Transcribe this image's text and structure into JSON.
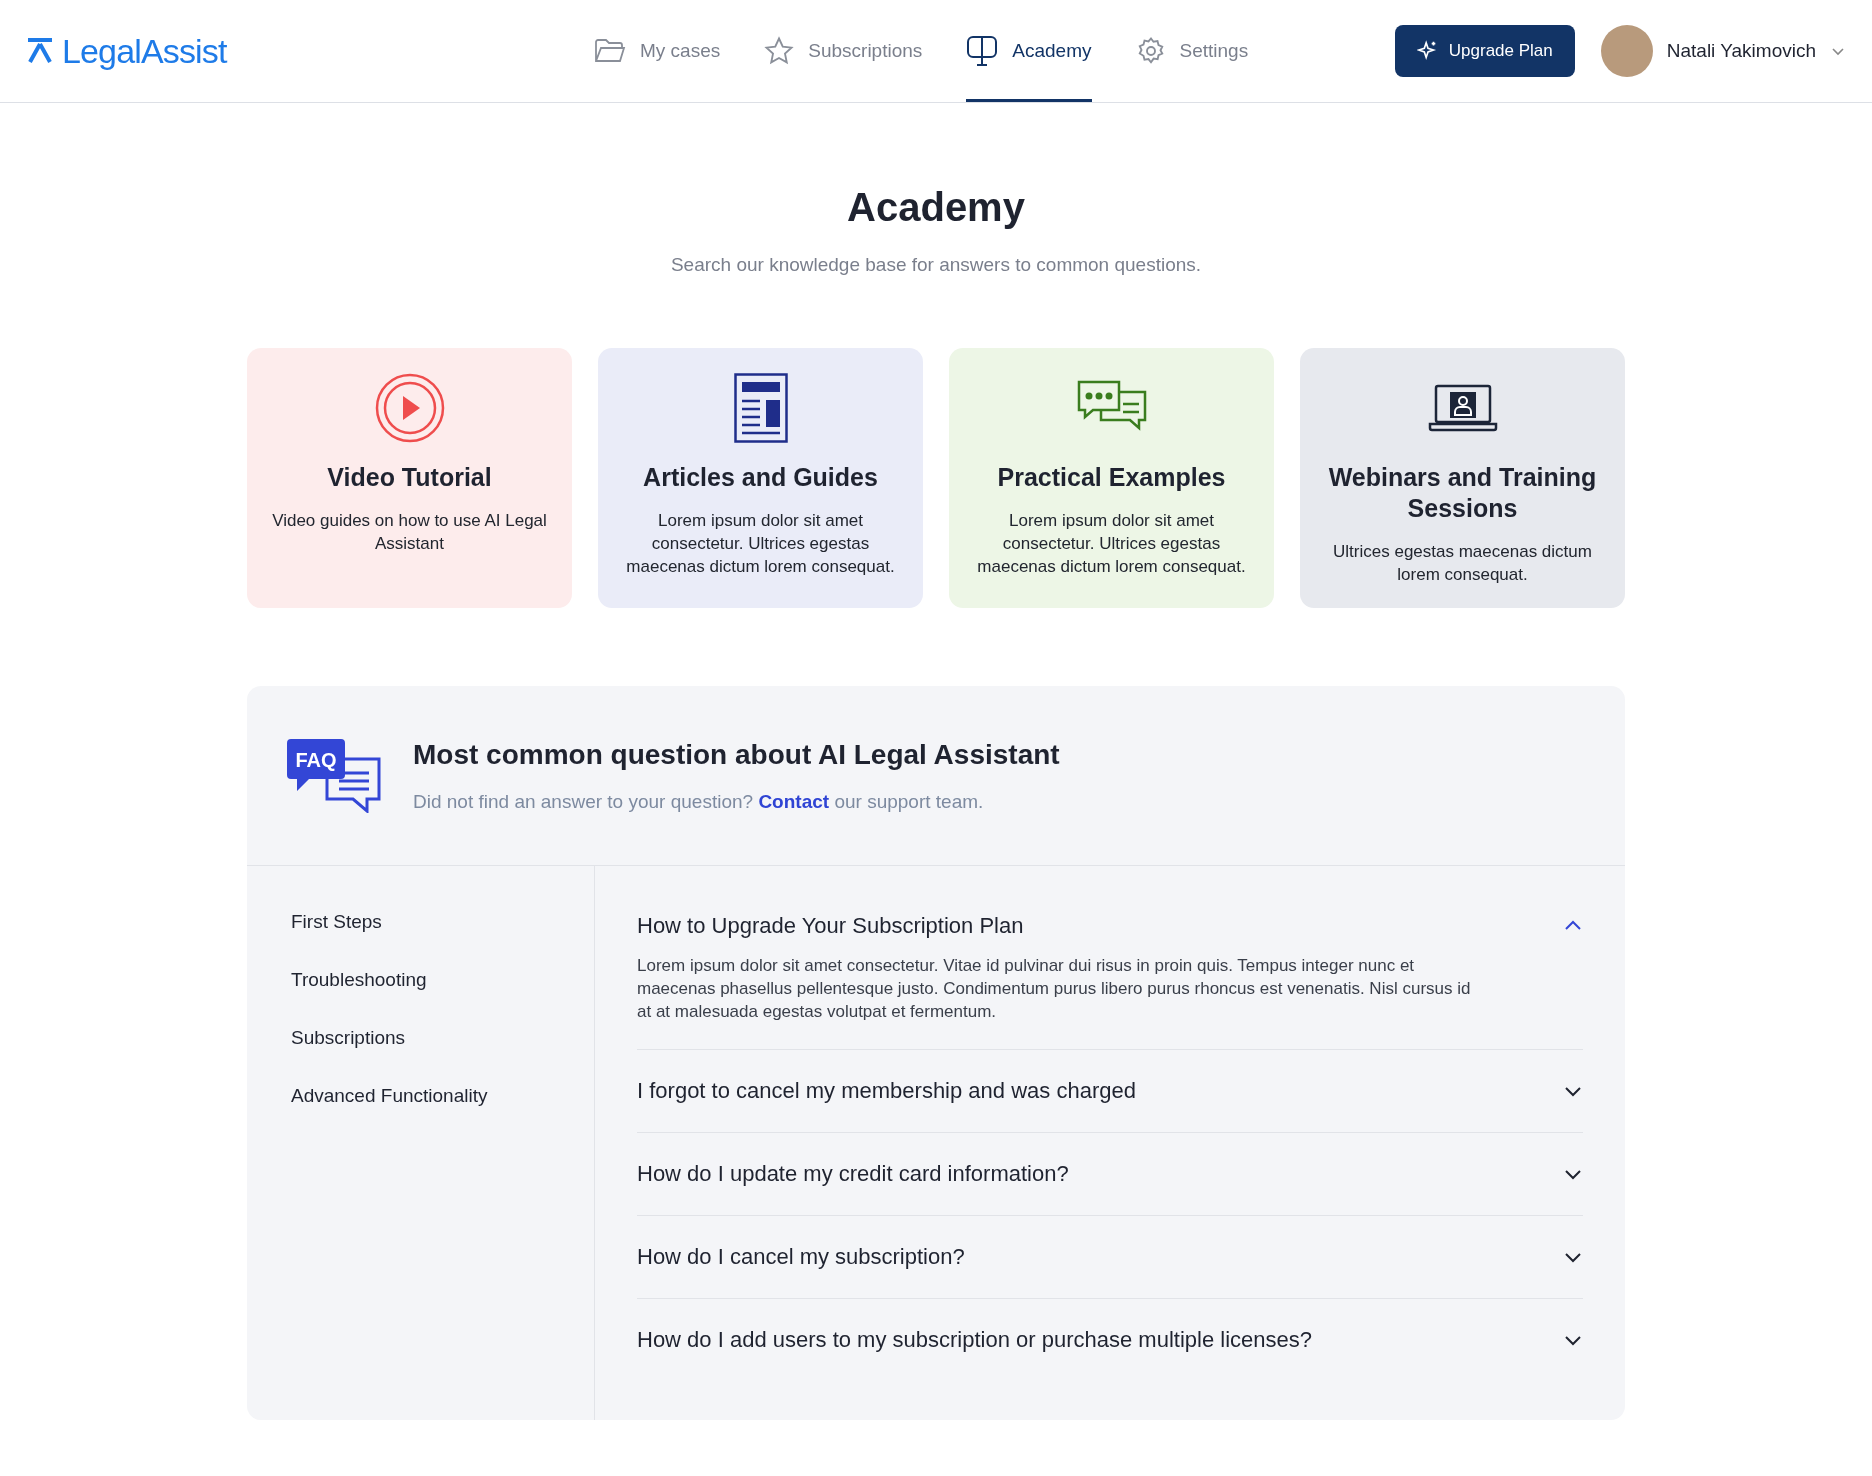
{
  "header": {
    "logo": "LegalAssist",
    "nav": [
      {
        "label": "My cases",
        "kind": "folder",
        "selected": false
      },
      {
        "label": "Subscriptions",
        "kind": "star",
        "selected": false
      },
      {
        "label": "Academy",
        "kind": "board",
        "selected": true
      },
      {
        "label": "Settings",
        "kind": "gear",
        "selected": false
      }
    ],
    "upgrade_button": "Upgrade Plan",
    "user": {
      "name": "Natali Yakimovich"
    }
  },
  "page": {
    "title": "Academy",
    "subtitle": "Search our knowledge base for answers to common questions."
  },
  "cards": [
    {
      "kind": "video",
      "title": "Video Tutorial",
      "text": "Video guides on how to use AI Legal Assistant"
    },
    {
      "kind": "articles",
      "title": "Articles and Guides",
      "text": "Lorem ipsum dolor sit amet consectetur. Ultrices egestas maecenas dictum lorem consequat."
    },
    {
      "kind": "examples",
      "title": "Practical Examples",
      "text": "Lorem ipsum dolor sit amet consectetur. Ultrices egestas maecenas dictum lorem consequat."
    },
    {
      "kind": "webinars",
      "title": "Webinars and Training Sessions",
      "text": "Ultrices egestas maecenas dictum lorem consequat."
    }
  ],
  "faq": {
    "badge": "FAQ",
    "title": "Most common question about AI Legal Assistant",
    "note_before": "Did not find an answer to your question?",
    "link": "Contact",
    "note_after": "our support team.",
    "categories": [
      "First Steps",
      "Troubleshooting",
      "Subscriptions",
      "Advanced Functionality"
    ],
    "questions": [
      {
        "question": "How to Upgrade Your Subscription Plan",
        "expanded": true,
        "answer": "Lorem ipsum dolor sit amet consectetur. Vitae id pulvinar dui risus in proin quis. Tempus integer nunc et maecenas phasellus pellentesque justo. Condimentum purus libero purus rhoncus est venenatis. Nisl cursus id at at malesuada egestas volutpat et fermentum."
      },
      {
        "question": "I forgot to cancel my membership and was charged",
        "expanded": false
      },
      {
        "question": "How do I update my credit card information?",
        "expanded": false
      },
      {
        "question": "How do I cancel my subscription?",
        "expanded": false
      },
      {
        "question": "How do I add users to my subscription or purchase multiple licenses?",
        "expanded": false
      }
    ]
  }
}
